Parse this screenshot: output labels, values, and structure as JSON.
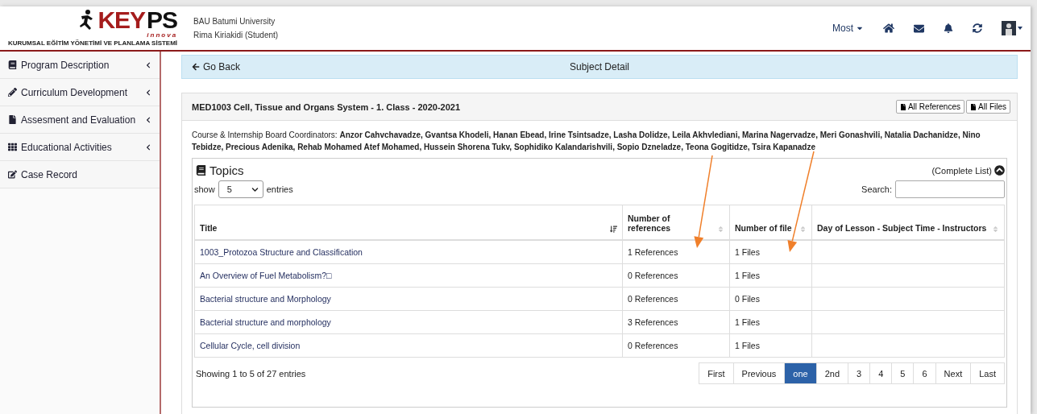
{
  "header": {
    "logo": {
      "red": "KEY",
      "black": "PS",
      "sub": "innova",
      "tagline": "KURUMSAL EĞİTİM YÖNETİMİ VE PLANLAMA SİSTEMİ"
    },
    "university": "BAU Batumi University",
    "user": "Rima Kiriakidi (Student)",
    "menu": "Most",
    "icons": [
      {
        "kind": "home"
      },
      {
        "kind": "mail"
      },
      {
        "kind": "bell"
      },
      {
        "kind": "refresh"
      },
      {
        "kind": "avatar"
      }
    ]
  },
  "sidebar": {
    "items": [
      {
        "label": "Program Description",
        "kind": "book",
        "expandable": true
      },
      {
        "label": "Curriculum Development",
        "kind": "pencil",
        "expandable": true
      },
      {
        "label": "Assesment and Evaluation",
        "kind": "file",
        "expandable": true
      },
      {
        "label": "Educational Activities",
        "kind": "grid",
        "expandable": true
      },
      {
        "label": "Case Record",
        "kind": "edit",
        "expandable": false
      }
    ]
  },
  "breadcrumb": {
    "back": "Go Back",
    "title": "Subject Detail"
  },
  "subject": {
    "title": "MED1003 Cell, Tissue and Organs System - 1. Class - 2020-2021",
    "buttons": [
      "All References",
      "All Files"
    ],
    "coordinators": "Course & Internship Board Coordinators: **Anzor Cahvchavadze, Gvantsa Khodeli, Hanan Ebead, Irine Tsintsadze, Lasha Dolidze, Leila Akhvlediani, Marina Nagervadze, Meri Gonashvili, Natalia Dachanidze, Nino Tebidze, Precious Adenika, Rehab Mohamed Atef Mohamed, Hussein Shorena Tukv, Sophidiko Kalandarishvili, Sopio Dzneladze, Teona Gogitidze, Tsira Kapanadze**"
  },
  "topics": {
    "title": "Topics",
    "complete_list": "(Complete List)",
    "show_label": "show",
    "page_size": "5",
    "entries_label": "entries",
    "search_label": "Search:",
    "table": {
      "columns": [
        {
          "label": "Title",
          "sorted": true
        },
        {
          "label": "Number of references",
          "sorted": false
        },
        {
          "label": "Number of file",
          "sorted": false
        },
        {
          "label": "Day of Lesson - Subject Time - Instructors",
          "sorted": false
        }
      ],
      "rows": [
        [
          "1003_Protozoa Structure and Classification",
          "1 References",
          "1 Files",
          ""
        ],
        [
          "An Overview of Fuel Metabolism?□",
          "0 References",
          "1 Files",
          ""
        ],
        [
          "Bacterial structure and Morphology",
          "0 References",
          "0 Files",
          ""
        ],
        [
          "Bacterial structure and morphology",
          "3 References",
          "1 Files",
          ""
        ],
        [
          "Cellular Cycle, cell division",
          "0 References",
          "1 Files",
          ""
        ]
      ]
    },
    "info": "Showing 1 to 5 of 27 entries",
    "pagination": [
      {
        "label": "First",
        "selected": false
      },
      {
        "label": "Previous",
        "selected": false
      },
      {
        "label": "one",
        "selected": true
      },
      {
        "label": "2nd",
        "selected": false
      },
      {
        "label": "3",
        "selected": false
      },
      {
        "label": "4",
        "selected": false
      },
      {
        "label": "5",
        "selected": false
      },
      {
        "label": "6",
        "selected": false
      },
      {
        "label": "Next",
        "selected": false
      },
      {
        "label": "Last",
        "selected": false
      }
    ]
  },
  "annotation_arrows": [
    {
      "color": "#f07f2a"
    },
    {
      "color": "#f07f2a"
    }
  ]
}
